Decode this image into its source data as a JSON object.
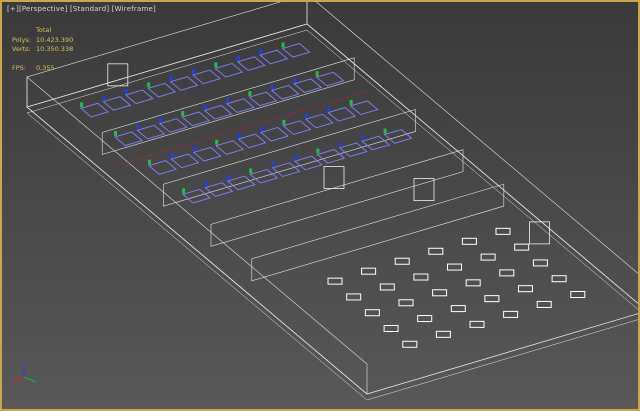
{
  "viewport": {
    "labels": [
      "[+]",
      "[Perspective]",
      "[Standard]",
      "[Wireframe]"
    ]
  },
  "stats": {
    "header": "Total",
    "polys_label": "Polys:",
    "polys_value": "10.423.390",
    "verts_label": "Verts:",
    "verts_value": "10.350.338",
    "fps_label": "FPS:",
    "fps_value": "0,355"
  },
  "gizmo": {
    "x": "x",
    "y": "y",
    "z": "z"
  },
  "colors": {
    "border": "#c8a84a",
    "stats": "#d8c25a",
    "wire": "#e6e6e6",
    "machine": "#8080ff",
    "blue": "#2040e0",
    "green": "#20c040",
    "red": "#c02020"
  }
}
